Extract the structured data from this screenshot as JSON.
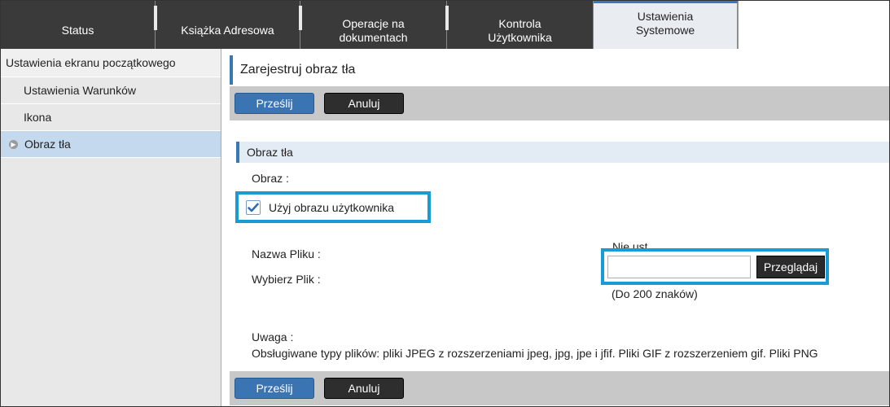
{
  "tabs": [
    {
      "label": "Status",
      "active": false
    },
    {
      "label": "Książka Adresowa",
      "active": false
    },
    {
      "label_lines": [
        "Operacje na",
        "dokumentach"
      ],
      "active": false
    },
    {
      "label_lines": [
        "Kontrola",
        "Użytkownika"
      ],
      "active": false
    },
    {
      "label_lines": [
        "Ustawienia",
        "Systemowe"
      ],
      "active": true
    }
  ],
  "sidebar": {
    "items": [
      {
        "label": "Ustawienia ekranu początkowego",
        "level": "top"
      },
      {
        "label": "Ustawienia Warunków",
        "level": "sub"
      },
      {
        "label": "Ikona",
        "level": "sub"
      },
      {
        "label": "Obraz tła",
        "level": "sub",
        "selected": true
      }
    ]
  },
  "main": {
    "page_title": "Zarejestruj obraz tła",
    "submit_label": "Prześlij",
    "cancel_label": "Anuluj",
    "section_title": "Obraz tła",
    "image_label": "Obraz :",
    "use_user_image_label": "Użyj obrazu użytkownika",
    "use_user_image_checked": true,
    "file_name_label": "Nazwa Pliku :",
    "file_name_value": "Nie ust",
    "choose_file_label": "Wybierz Plik :",
    "file_input_value": "",
    "browse_label": "Przeglądaj",
    "file_hint": "(Do 200 znaków)",
    "note_label": "Uwaga :",
    "note_text": "Obsługiwane typy plików: pliki JPEG z rozszerzeniami jpeg, jpg, jpe i jfif. Pliki GIF z rozszerzeniem gif. Pliki PNG"
  },
  "colors": {
    "accent": "#3877b8",
    "highlight_border": "#1a9bd6",
    "tabbar": "#3a3a3a",
    "sidebar_selected": "#c4d9ee"
  }
}
